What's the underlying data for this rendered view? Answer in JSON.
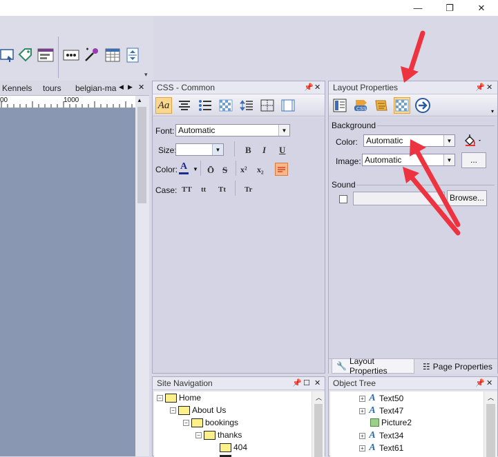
{
  "window": {
    "minimize_glyph": "—",
    "restore_glyph": "❐",
    "close_glyph": "✕"
  },
  "documents": {
    "tabs": [
      "Kennels",
      "tours",
      "belgian-ma"
    ],
    "nav_prev": "◀",
    "nav_next": "▶",
    "close": "✕"
  },
  "ruler": {
    "left_mark": "00",
    "mid_mark": "1000"
  },
  "css_common": {
    "title": "CSS - Common",
    "font_label": "Font:",
    "font_value": "Automatic",
    "size_label": "Size:",
    "size_value": "",
    "color_label": "Color:",
    "case_label": "Case:",
    "bold": "B",
    "italic": "I",
    "underline": "U",
    "overline": "Ō",
    "strike": "S",
    "superscript": "x²",
    "subscript": "x₂",
    "case_upper": "TT",
    "case_lower": "tt",
    "case_title": "Tt",
    "case_reset": "Tr"
  },
  "layout_properties": {
    "title": "Layout Properties",
    "background_group": "Background",
    "color_label": "Color:",
    "color_value": "Automatic",
    "image_label": "Image:",
    "image_value": "Automatic",
    "image_browse": "...",
    "sound_group": "Sound",
    "sound_value": "",
    "browse_button": "Browse...",
    "tab_layout": "Layout Properties",
    "tab_page": "Page Properties"
  },
  "site_navigation": {
    "title": "Site Navigation",
    "nodes": [
      "Home",
      "About Us",
      "bookings",
      "thanks",
      "404"
    ]
  },
  "object_tree": {
    "title": "Object Tree",
    "nodes": [
      "Text50",
      "Text47",
      "Picture2",
      "Text34",
      "Text61"
    ]
  },
  "colors": {
    "accent_red": "#ee3340",
    "active_button": "#fbd88d",
    "design_area": "#8a97b3"
  }
}
